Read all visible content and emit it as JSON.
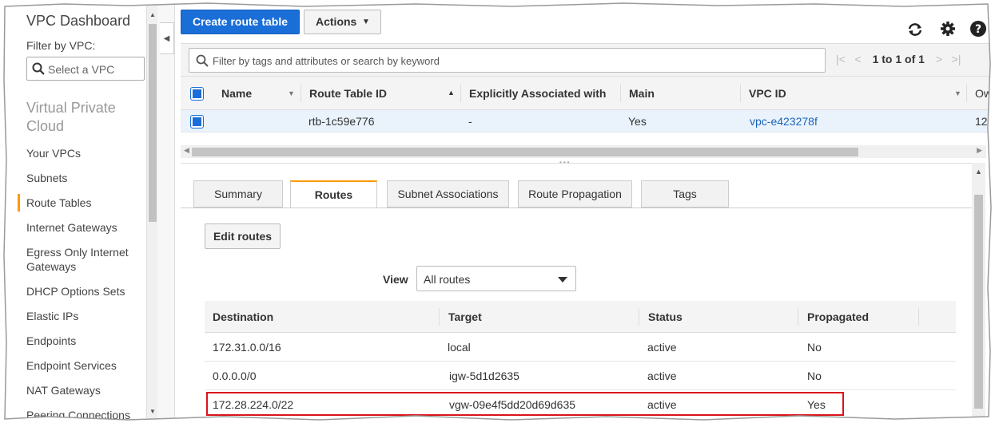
{
  "sidebar": {
    "title": "VPC Dashboard",
    "filter_label": "Filter by VPC:",
    "select_placeholder": "Select a VPC",
    "section": "Virtual Private Cloud",
    "items": [
      {
        "label": "Your VPCs"
      },
      {
        "label": "Subnets"
      },
      {
        "label": "Route Tables"
      },
      {
        "label": "Internet Gateways"
      },
      {
        "label": "Egress Only Internet Gateways"
      },
      {
        "label": "DHCP Options Sets"
      },
      {
        "label": "Elastic IPs"
      },
      {
        "label": "Endpoints"
      },
      {
        "label": "Endpoint Services"
      },
      {
        "label": "NAT Gateways"
      },
      {
        "label": "Peering Connections"
      }
    ]
  },
  "toolbar": {
    "create_label": "Create route table",
    "actions_label": "Actions"
  },
  "search": {
    "placeholder": "Filter by tags and attributes or search by keyword",
    "pager_text": "1 to 1 of 1"
  },
  "route_tables": {
    "columns": [
      "Name",
      "Route Table ID",
      "Explicitly Associated with",
      "Main",
      "VPC ID",
      "Ow"
    ],
    "rows": [
      {
        "name": "",
        "id": "rtb-1c59e776",
        "assoc": "-",
        "main": "Yes",
        "vpc": "vpc-e423278f",
        "owner": "12"
      }
    ]
  },
  "tabs": [
    "Summary",
    "Routes",
    "Subnet Associations",
    "Route Propagation",
    "Tags"
  ],
  "routes_panel": {
    "edit_label": "Edit routes",
    "view_label": "View",
    "view_value": "All routes",
    "columns": [
      "Destination",
      "Target",
      "Status",
      "Propagated"
    ],
    "rows": [
      {
        "destination": "172.31.0.0/16",
        "target": "local",
        "status": "active",
        "propagated": "No"
      },
      {
        "destination": "0.0.0.0/0",
        "target": "igw-5d1d2635",
        "status": "active",
        "propagated": "No"
      },
      {
        "destination": "172.28.224.0/22",
        "target": "vgw-09e4f5dd20d69d635",
        "status": "active",
        "propagated": "Yes"
      }
    ]
  },
  "colors": {
    "primary": "#1a6ed8",
    "accent": "#ff9900",
    "link": "#1a64b8",
    "status_active": "#1d8102",
    "highlight": "#d9141a"
  }
}
